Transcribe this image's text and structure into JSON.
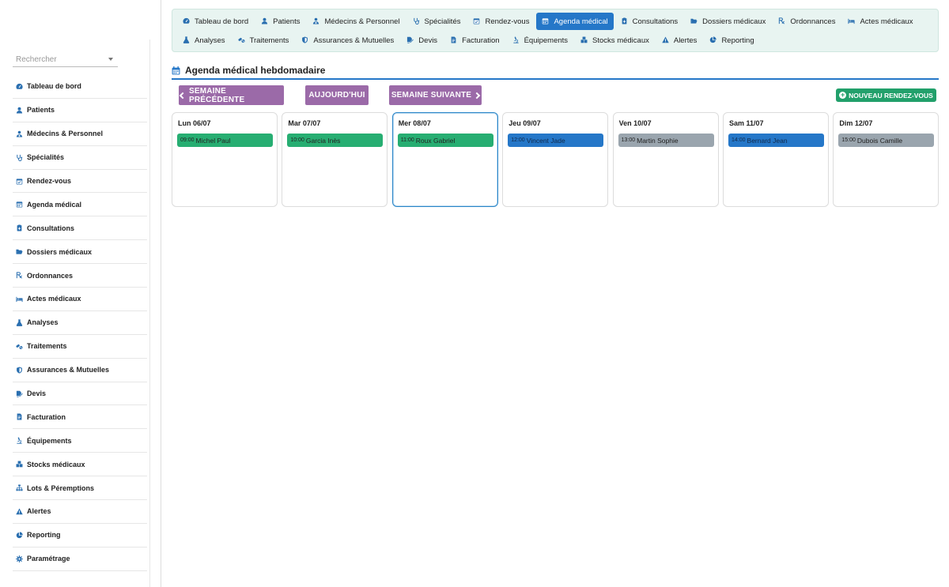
{
  "sidebar": {
    "search_placeholder": "Rechercher",
    "items": [
      {
        "label": "Tableau de bord",
        "icon": "dashboard-icon"
      },
      {
        "label": "Patients",
        "icon": "user-icon"
      },
      {
        "label": "Médecins & Personnel",
        "icon": "user-doctor-icon"
      },
      {
        "label": "Spécialités",
        "icon": "stethoscope-icon"
      },
      {
        "label": "Rendez-vous",
        "icon": "calendar-check-icon"
      },
      {
        "label": "Agenda médical",
        "icon": "calendar-icon"
      },
      {
        "label": "Consultations",
        "icon": "clipboard-icon"
      },
      {
        "label": "Dossiers médicaux",
        "icon": "folder-open-icon"
      },
      {
        "label": "Ordonnances",
        "icon": "prescription-icon"
      },
      {
        "label": "Actes médicaux",
        "icon": "bed-icon"
      },
      {
        "label": "Analyses",
        "icon": "flask-icon"
      },
      {
        "label": "Traitements",
        "icon": "pills-icon"
      },
      {
        "label": "Assurances & Mutuelles",
        "icon": "shield-icon"
      },
      {
        "label": "Devis",
        "icon": "file-signature-icon"
      },
      {
        "label": "Facturation",
        "icon": "invoice-icon"
      },
      {
        "label": "Équipements",
        "icon": "microscope-icon"
      },
      {
        "label": "Stocks médicaux",
        "icon": "boxes-icon"
      },
      {
        "label": "Lots & Péremptions",
        "icon": "sitemap-icon"
      },
      {
        "label": "Alertes",
        "icon": "warning-icon"
      },
      {
        "label": "Reporting",
        "icon": "pie-chart-icon"
      },
      {
        "label": "Paramétrage",
        "icon": "gear-icon"
      }
    ]
  },
  "topnav": {
    "row1": [
      {
        "label": "Tableau de bord",
        "icon": "dashboard-icon",
        "active": false
      },
      {
        "label": "Patients",
        "icon": "user-icon",
        "active": false
      },
      {
        "label": "Médecins & Personnel",
        "icon": "user-doctor-icon",
        "active": false
      },
      {
        "label": "Spécialités",
        "icon": "stethoscope-icon",
        "active": false
      },
      {
        "label": "Rendez-vous",
        "icon": "calendar-check-icon",
        "active": false
      },
      {
        "label": "Agenda médical",
        "icon": "calendar-icon",
        "active": true
      },
      {
        "label": "Consultations",
        "icon": "clipboard-icon",
        "active": false
      },
      {
        "label": "Dossiers médicaux",
        "icon": "folder-open-icon",
        "active": false
      },
      {
        "label": "Ordonnances",
        "icon": "prescription-icon",
        "active": false
      },
      {
        "label": "Actes médicaux",
        "icon": "bed-icon",
        "active": false
      }
    ],
    "row2": [
      {
        "label": "Analyses",
        "icon": "flask-icon",
        "active": false
      },
      {
        "label": "Traitements",
        "icon": "pills-icon",
        "active": false
      },
      {
        "label": "Assurances & Mutuelles",
        "icon": "shield-icon",
        "active": false
      },
      {
        "label": "Devis",
        "icon": "file-signature-icon",
        "active": false
      },
      {
        "label": "Facturation",
        "icon": "invoice-icon",
        "active": false
      },
      {
        "label": "Équipements",
        "icon": "microscope-icon",
        "active": false
      },
      {
        "label": "Stocks médicaux",
        "icon": "boxes-icon",
        "active": false
      },
      {
        "label": "Alertes",
        "icon": "warning-icon",
        "active": false
      },
      {
        "label": "Reporting",
        "icon": "pie-chart-icon",
        "active": false
      }
    ]
  },
  "page": {
    "title": "Agenda médical hebdomadaire",
    "title_icon": "calendar-icon"
  },
  "toolbar": {
    "prev_label": "SEMAINE PRÉCÉDENTE",
    "today_label": "AUJOURD'HUI",
    "next_label": "SEMAINE SUIVANTE",
    "new_label": "NOUVEAU RENDEZ-VOUS"
  },
  "week": {
    "days": [
      {
        "label": "Lun 06/07",
        "today": false,
        "appointments": [
          {
            "time": "09:00",
            "patient": "Michel Paul",
            "color": "#27ae72",
            "text_color": "#222"
          }
        ]
      },
      {
        "label": "Mar 07/07",
        "today": false,
        "appointments": [
          {
            "time": "10:00",
            "patient": "Garcia Inès",
            "color": "#27ae72",
            "text_color": "#222"
          }
        ]
      },
      {
        "label": "Mer 08/07",
        "today": true,
        "appointments": [
          {
            "time": "11:00",
            "patient": "Roux Gabriel",
            "color": "#27ae72",
            "text_color": "#222"
          }
        ]
      },
      {
        "label": "Jeu 09/07",
        "today": false,
        "appointments": [
          {
            "time": "12:00",
            "patient": "Vincent Jade",
            "color": "#2577c8",
            "text_color": "#10294a"
          }
        ]
      },
      {
        "label": "Ven 10/07",
        "today": false,
        "appointments": [
          {
            "time": "13:00",
            "patient": "Martin Sophie",
            "color": "#9aa5ae",
            "text_color": "#222"
          }
        ]
      },
      {
        "label": "Sam 11/07",
        "today": false,
        "appointments": [
          {
            "time": "14:00",
            "patient": "Bernard Jean",
            "color": "#2577c8",
            "text_color": "#10294a"
          }
        ]
      },
      {
        "label": "Dim 12/07",
        "today": false,
        "appointments": [
          {
            "time": "15:00",
            "patient": "Dubois Camille",
            "color": "#9aa5ae",
            "text_color": "#222"
          }
        ]
      }
    ]
  },
  "colors": {
    "primary": "#2577c8",
    "nav_bg": "#e8f4f1",
    "week_buttons": "#9b6aa8",
    "new_button": "#22a06b"
  }
}
